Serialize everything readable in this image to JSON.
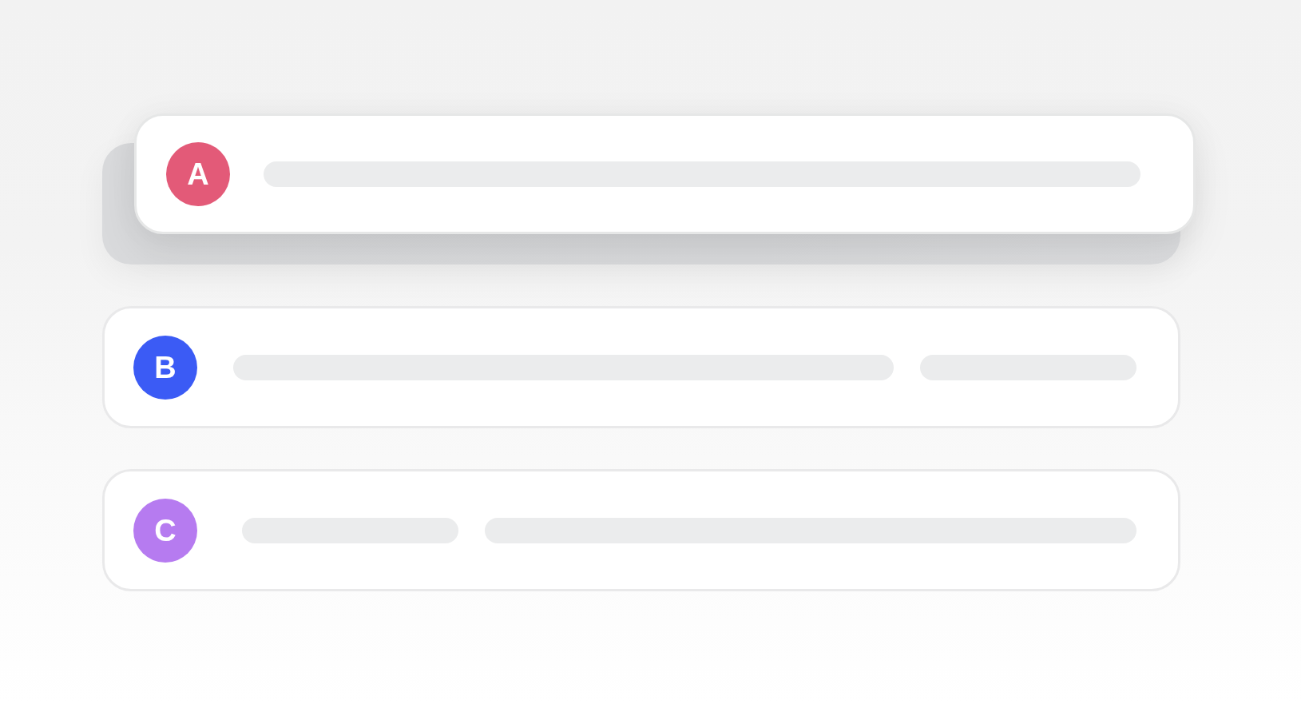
{
  "cards": [
    {
      "initial": "A",
      "color": "#e35a78",
      "kind": "single",
      "dragging": true
    },
    {
      "initial": "B",
      "color": "#3b5bf5",
      "kind": "widenarrow",
      "dragging": false
    },
    {
      "initial": "C",
      "color": "#b67bf0",
      "kind": "narrowwide",
      "dragging": false
    }
  ]
}
